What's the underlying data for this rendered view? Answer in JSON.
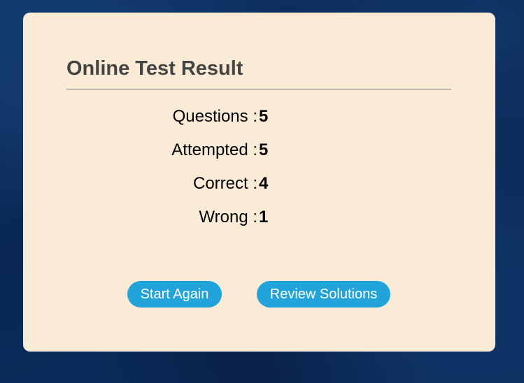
{
  "result": {
    "title": "Online Test Result",
    "stats": [
      {
        "label": "Questions :",
        "value": "5"
      },
      {
        "label": "Attempted :",
        "value": "5"
      },
      {
        "label": "Correct :",
        "value": "4"
      },
      {
        "label": "Wrong :",
        "value": "1"
      }
    ]
  },
  "actions": {
    "start_again_label": "Start Again",
    "review_solutions_label": "Review Solutions"
  },
  "colors": {
    "card_background": "#faebd7",
    "button": "#22a3d9",
    "page_background": "#0b2b5c"
  }
}
